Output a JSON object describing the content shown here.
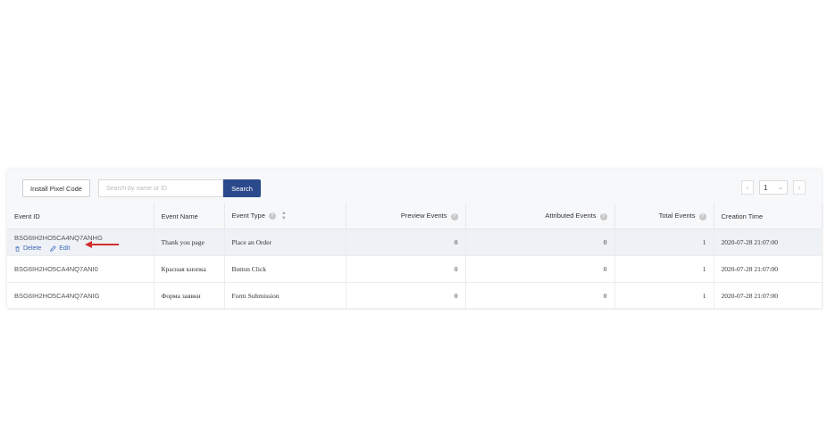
{
  "toolbar": {
    "install_label": "Install Pixel Code",
    "search_placeholder": "Search by name or ID",
    "search_button": "Search"
  },
  "pagination": {
    "prev_icon": "chevron-left-icon",
    "page": "1",
    "next_icon": "chevron-right-icon"
  },
  "table": {
    "headers": {
      "event_id": "Event ID",
      "event_name": "Event Name",
      "event_type": "Event Type",
      "preview_events": "Preview Events",
      "attributed_events": "Attributed Events",
      "total_events": "Total Events",
      "creation_time": "Creation Time"
    },
    "rows": [
      {
        "event_id": "BSG6IH2HO5CA4NQ7ANHG",
        "event_name": "Thank you page",
        "event_type": "Place an Order",
        "preview_events": "0",
        "attributed_events": "0",
        "total_events": "1",
        "creation_time": "2020-07-28 21:07:00",
        "delete_label": "Delete",
        "edit_label": "Edit"
      },
      {
        "event_id": "BSG6IH2HO5CA4NQ7ANI0",
        "event_name": "Красная кнопка",
        "event_type": "Button Click",
        "preview_events": "0",
        "attributed_events": "0",
        "total_events": "1",
        "creation_time": "2020-07-28 21:07:00"
      },
      {
        "event_id": "BSG6IH2HO5CA4NQ7ANIG",
        "event_name": "Форма заявки",
        "event_type": "Form Submission",
        "preview_events": "0",
        "attributed_events": "0",
        "total_events": "1",
        "creation_time": "2020-07-28 21:07:00"
      }
    ]
  },
  "colors": {
    "primary": "#2b4a8b",
    "link": "#3a66b8",
    "annotation_arrow": "#d32f2f",
    "highlight_row": "#eef1f6"
  }
}
